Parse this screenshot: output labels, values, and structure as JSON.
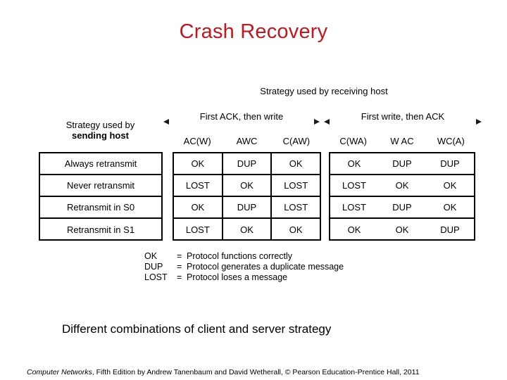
{
  "slide": {
    "title": "Crash Recovery",
    "title_color": "#C4161C",
    "caption": "Different combinations of client and server strategy"
  },
  "figure": {
    "receiving_host_title": "Strategy used by receiving host",
    "sending_host_title_line1": "Strategy used by",
    "sending_host_title_line2": "sending host",
    "span_groups": [
      {
        "label": "First ACK, then write",
        "left_arrow": "arrow-left-icon",
        "right_arrow": "arrow-right-icon"
      },
      {
        "label": "First  write, then ACK",
        "left_arrow": "arrow-left-icon",
        "right_arrow": "arrow-right-icon"
      }
    ],
    "columns_left": [
      "AC(W)",
      "AWC",
      "C(AW)"
    ],
    "columns_right": [
      "C(WA)",
      "W AC",
      "WC(A)"
    ],
    "row_labels": [
      "Always retransmit",
      "Never retransmit",
      "Retransmit in S0",
      "Retransmit in S1"
    ],
    "cells_left": [
      [
        "OK",
        "DUP",
        "OK"
      ],
      [
        "LOST",
        "OK",
        "LOST"
      ],
      [
        "OK",
        "DUP",
        "LOST"
      ],
      [
        "LOST",
        "OK",
        "OK"
      ]
    ],
    "cells_right": [
      [
        "OK",
        "DUP",
        "DUP"
      ],
      [
        "LOST",
        "OK",
        "OK"
      ],
      [
        "LOST",
        "DUP",
        "OK"
      ],
      [
        "OK",
        "OK",
        "DUP"
      ]
    ],
    "legend": [
      {
        "key": "OK",
        "eq": "=",
        "desc": "Protocol functions correctly"
      },
      {
        "key": "DUP",
        "eq": "=",
        "desc": "Protocol generates a duplicate message"
      },
      {
        "key": "LOST",
        "eq": "=",
        "desc": "Protocol loses a message"
      }
    ]
  },
  "footer": {
    "italic_part": "Computer Networks",
    "rest_part": ", Fifth Edition by Andrew Tanenbaum and David Wetherall, © Pearson Education-Prentice Hall, 2011"
  }
}
